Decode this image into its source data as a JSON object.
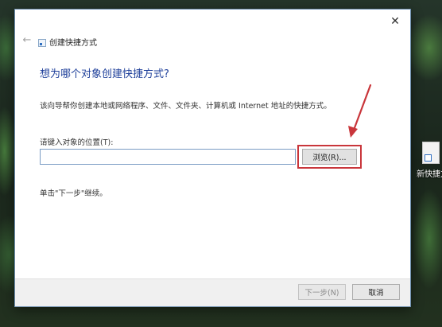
{
  "desktop": {
    "icon_label": "新快捷方"
  },
  "dialog": {
    "window_title": "创建快捷方式",
    "close_glyph": "✕",
    "back_glyph": "←",
    "heading": "想为哪个对象创建快捷方式?",
    "description": "该向导帮你创建本地或网络程序、文件、文件夹、计算机或 Internet 地址的快捷方式。",
    "location_label": "请键入对象的位置(T):",
    "location_value": "",
    "browse_label": "浏览(R)...",
    "hint": "单击\"下一步\"继续。",
    "next_label": "下一步(N)",
    "cancel_label": "取消"
  },
  "annotation": {
    "color": "#c9363b"
  }
}
